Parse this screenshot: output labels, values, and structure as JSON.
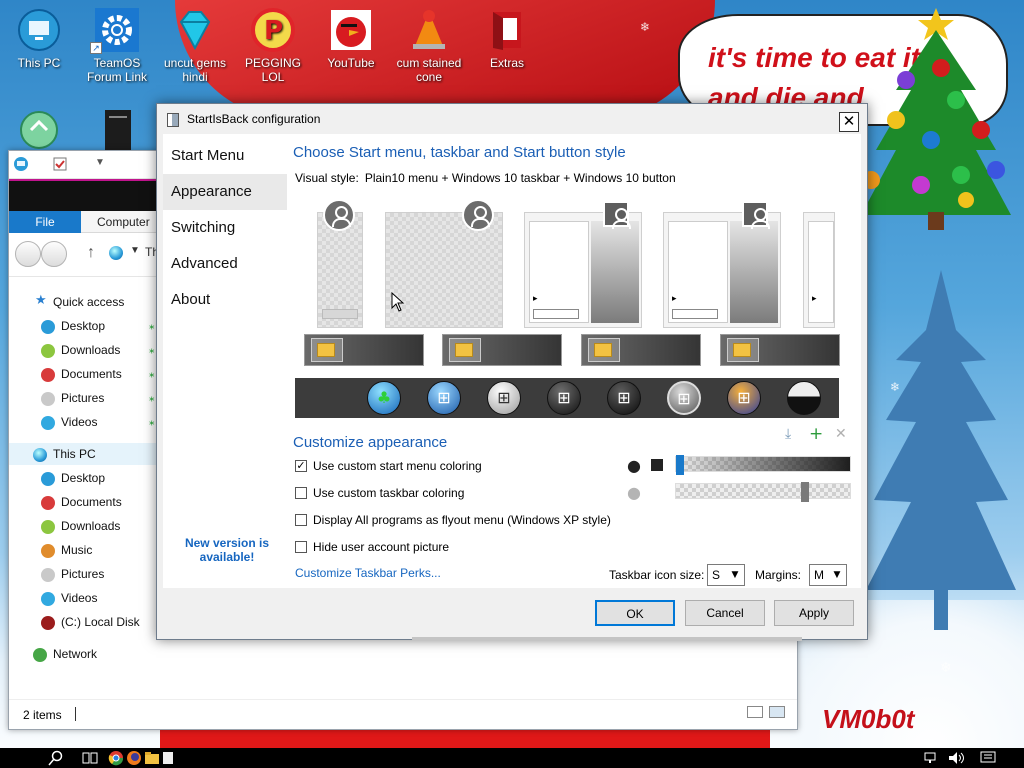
{
  "desktop": {
    "icons": [
      {
        "label": "This PC",
        "icon": "this-pc-icon"
      },
      {
        "label": "TeamOS Forum Link",
        "icon": "gear-icon"
      },
      {
        "label": "uncut gems hindi",
        "icon": "diamond-icon"
      },
      {
        "label": "PEGGING LOL",
        "icon": "p-logo-icon"
      },
      {
        "label": "YouTube",
        "icon": "angry-bird-icon"
      },
      {
        "label": "cum stained cone",
        "icon": "vlc-cone-icon"
      },
      {
        "label": "Extras",
        "icon": "extras-icon"
      }
    ],
    "speech_bubble": "it's time to eat it\nand die and",
    "signature": "VM0b0t"
  },
  "explorer": {
    "ribbon_tabs": [
      "File",
      "Computer"
    ],
    "address_text": "Th",
    "nav": {
      "quick_access": "Quick access",
      "quick_items": [
        "Desktop",
        "Downloads",
        "Documents",
        "Pictures",
        "Videos"
      ],
      "this_pc": "This PC",
      "pc_items": [
        "Desktop",
        "Documents",
        "Downloads",
        "Music",
        "Pictures",
        "Videos",
        "(C:) Local Disk"
      ],
      "network": "Network"
    },
    "status": "2 items"
  },
  "dialog": {
    "title": "StartIsBack configuration",
    "nav_items": [
      "Start Menu",
      "Appearance",
      "Switching",
      "Advanced",
      "About"
    ],
    "active_nav": "Appearance",
    "new_version": "New version is available!",
    "style_heading": "Choose Start menu, taskbar and Start button style",
    "visual_style_label": "Visual style:",
    "visual_style_value": "Plain10 menu + Windows 10 taskbar + Windows 10 button",
    "customize_heading": "Customize appearance",
    "options": [
      {
        "label": "Use custom start menu coloring",
        "checked": true
      },
      {
        "label": "Use custom taskbar coloring",
        "checked": false
      },
      {
        "label": "Display All programs as flyout menu (Windows XP style)",
        "checked": false
      },
      {
        "label": "Hide user account picture",
        "checked": false
      }
    ],
    "perks_link": "Customize Taskbar Perks...",
    "icon_size_label": "Taskbar icon size:",
    "icon_size_value": "S",
    "margins_label": "Margins:",
    "margins_value": "M",
    "buttons": {
      "ok": "OK",
      "cancel": "Cancel",
      "apply": "Apply"
    },
    "start_menu_slider_level": 0.0,
    "taskbar_slider_level": 0.75
  },
  "colors": {
    "accent_blue": "#1b5fb5",
    "link_blue": "#1666c0",
    "slider_thumb": "#1979ca",
    "default_button_border": "#0078d7"
  }
}
